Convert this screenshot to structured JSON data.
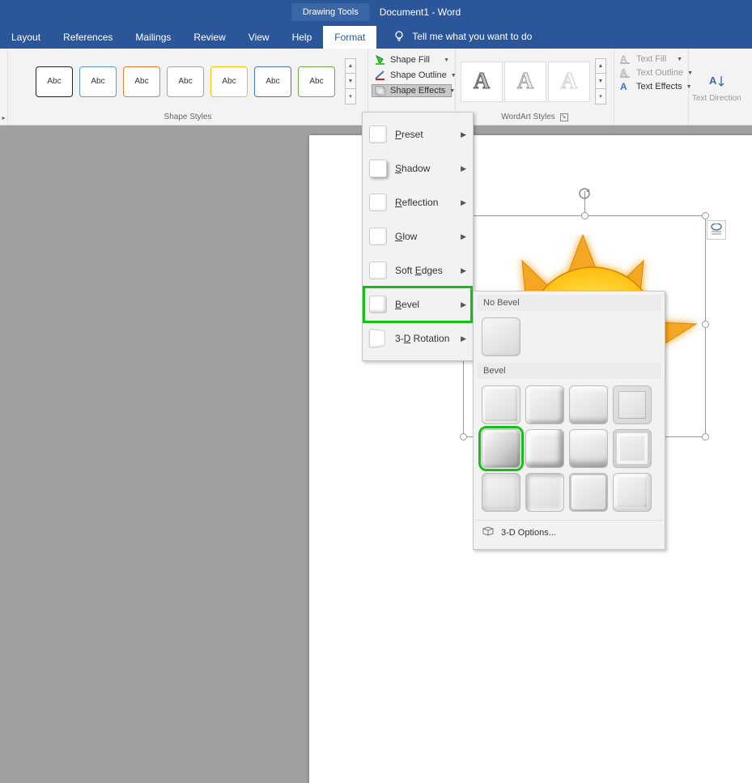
{
  "titlebar": {
    "tool_context": "Drawing Tools",
    "doc_title": "Document1  -  Word"
  },
  "tabs": {
    "items": [
      "Layout",
      "References",
      "Mailings",
      "Review",
      "View",
      "Help",
      "Format"
    ],
    "active": "Format",
    "tell_me": "Tell me what you want to do"
  },
  "ribbon": {
    "shape_styles": {
      "label": "Shape Styles",
      "thumbs": [
        "Abc",
        "Abc",
        "Abc",
        "Abc",
        "Abc",
        "Abc",
        "Abc"
      ]
    },
    "shape_fill": "Shape Fill",
    "shape_outline": "Shape Outline",
    "shape_effects": "Shape Effects",
    "wordart_styles": {
      "label": "WordArt Styles",
      "thumbs": [
        "A",
        "A",
        "A"
      ]
    },
    "text_fill": "Text Fill",
    "text_outline": "Text Outline",
    "text_effects": "Text Effects",
    "text_direction": "Text Direction"
  },
  "effects_menu": {
    "items": [
      {
        "label_pre": "",
        "ul": "P",
        "label_post": "reset"
      },
      {
        "label_pre": "",
        "ul": "S",
        "label_post": "hadow"
      },
      {
        "label_pre": "",
        "ul": "R",
        "label_post": "eflection"
      },
      {
        "label_pre": "",
        "ul": "G",
        "label_post": "low"
      },
      {
        "label_pre": "Soft ",
        "ul": "E",
        "label_post": "dges"
      },
      {
        "label_pre": "",
        "ul": "B",
        "label_post": "evel"
      },
      {
        "label_pre": "3-",
        "ul": "D",
        "label_post": " Rotation"
      }
    ]
  },
  "bevel_menu": {
    "no_bevel_label": "No Bevel",
    "bevel_label": "Bevel",
    "three_d_options": "3-D Options..."
  }
}
